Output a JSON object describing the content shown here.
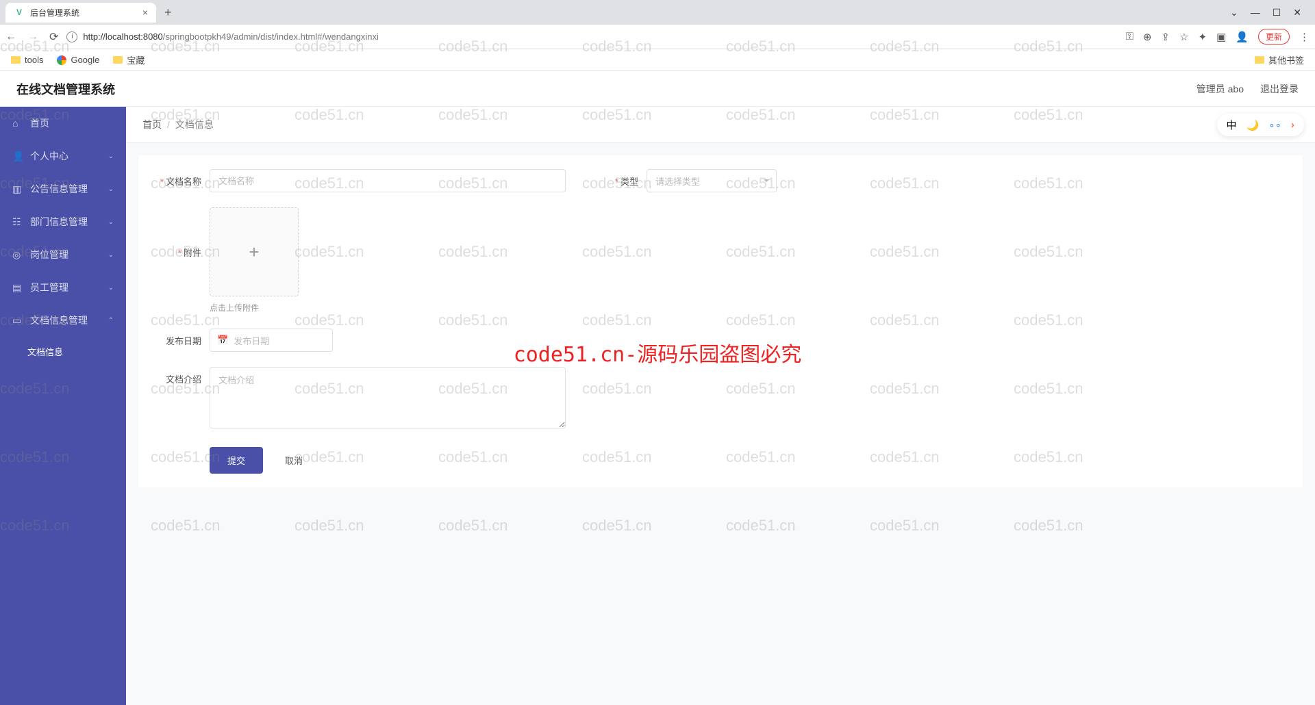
{
  "browser": {
    "tab_title": "后台管理系统",
    "url_host": "http://localhost:8080",
    "url_path": "/springbootpkh49/admin/dist/index.html#/wendangxinxi",
    "update_label": "更新",
    "bookmarks": {
      "tools": "tools",
      "google": "Google",
      "treasure": "宝藏",
      "other": "其他书签"
    }
  },
  "header": {
    "app_title": "在线文档管理系统",
    "user_label": "管理员 abo",
    "logout": "退出登录"
  },
  "sidebar": {
    "home": "首页",
    "personal": "个人中心",
    "notice": "公告信息管理",
    "dept": "部门信息管理",
    "position": "岗位管理",
    "staff": "员工管理",
    "doc_mgmt": "文档信息管理",
    "doc_info": "文档信息"
  },
  "breadcrumb": {
    "home": "首页",
    "current": "文档信息"
  },
  "float_tools": {
    "lang": "中"
  },
  "form": {
    "doc_name_label": "文档名称",
    "doc_name_placeholder": "文档名称",
    "type_label": "类型",
    "type_placeholder": "请选择类型",
    "attach_label": "附件",
    "upload_hint": "点击上传附件",
    "publish_date_label": "发布日期",
    "publish_date_placeholder": "发布日期",
    "intro_label": "文档介绍",
    "intro_placeholder": "文档介绍",
    "submit": "提交",
    "cancel": "取消"
  },
  "watermark": {
    "text": "code51.cn",
    "center": "code51.cn-源码乐园盗图必究"
  }
}
